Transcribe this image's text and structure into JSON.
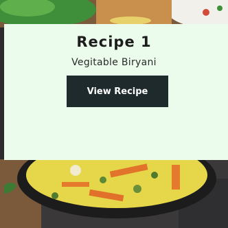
{
  "card": {
    "title": "Recipe 1",
    "subtitle": "Vegitable Biryani",
    "button_label": "View Recipe"
  },
  "colors": {
    "card_background": "#ebfbec",
    "button_background": "#1f2a2d",
    "button_text": "#ffffff"
  }
}
